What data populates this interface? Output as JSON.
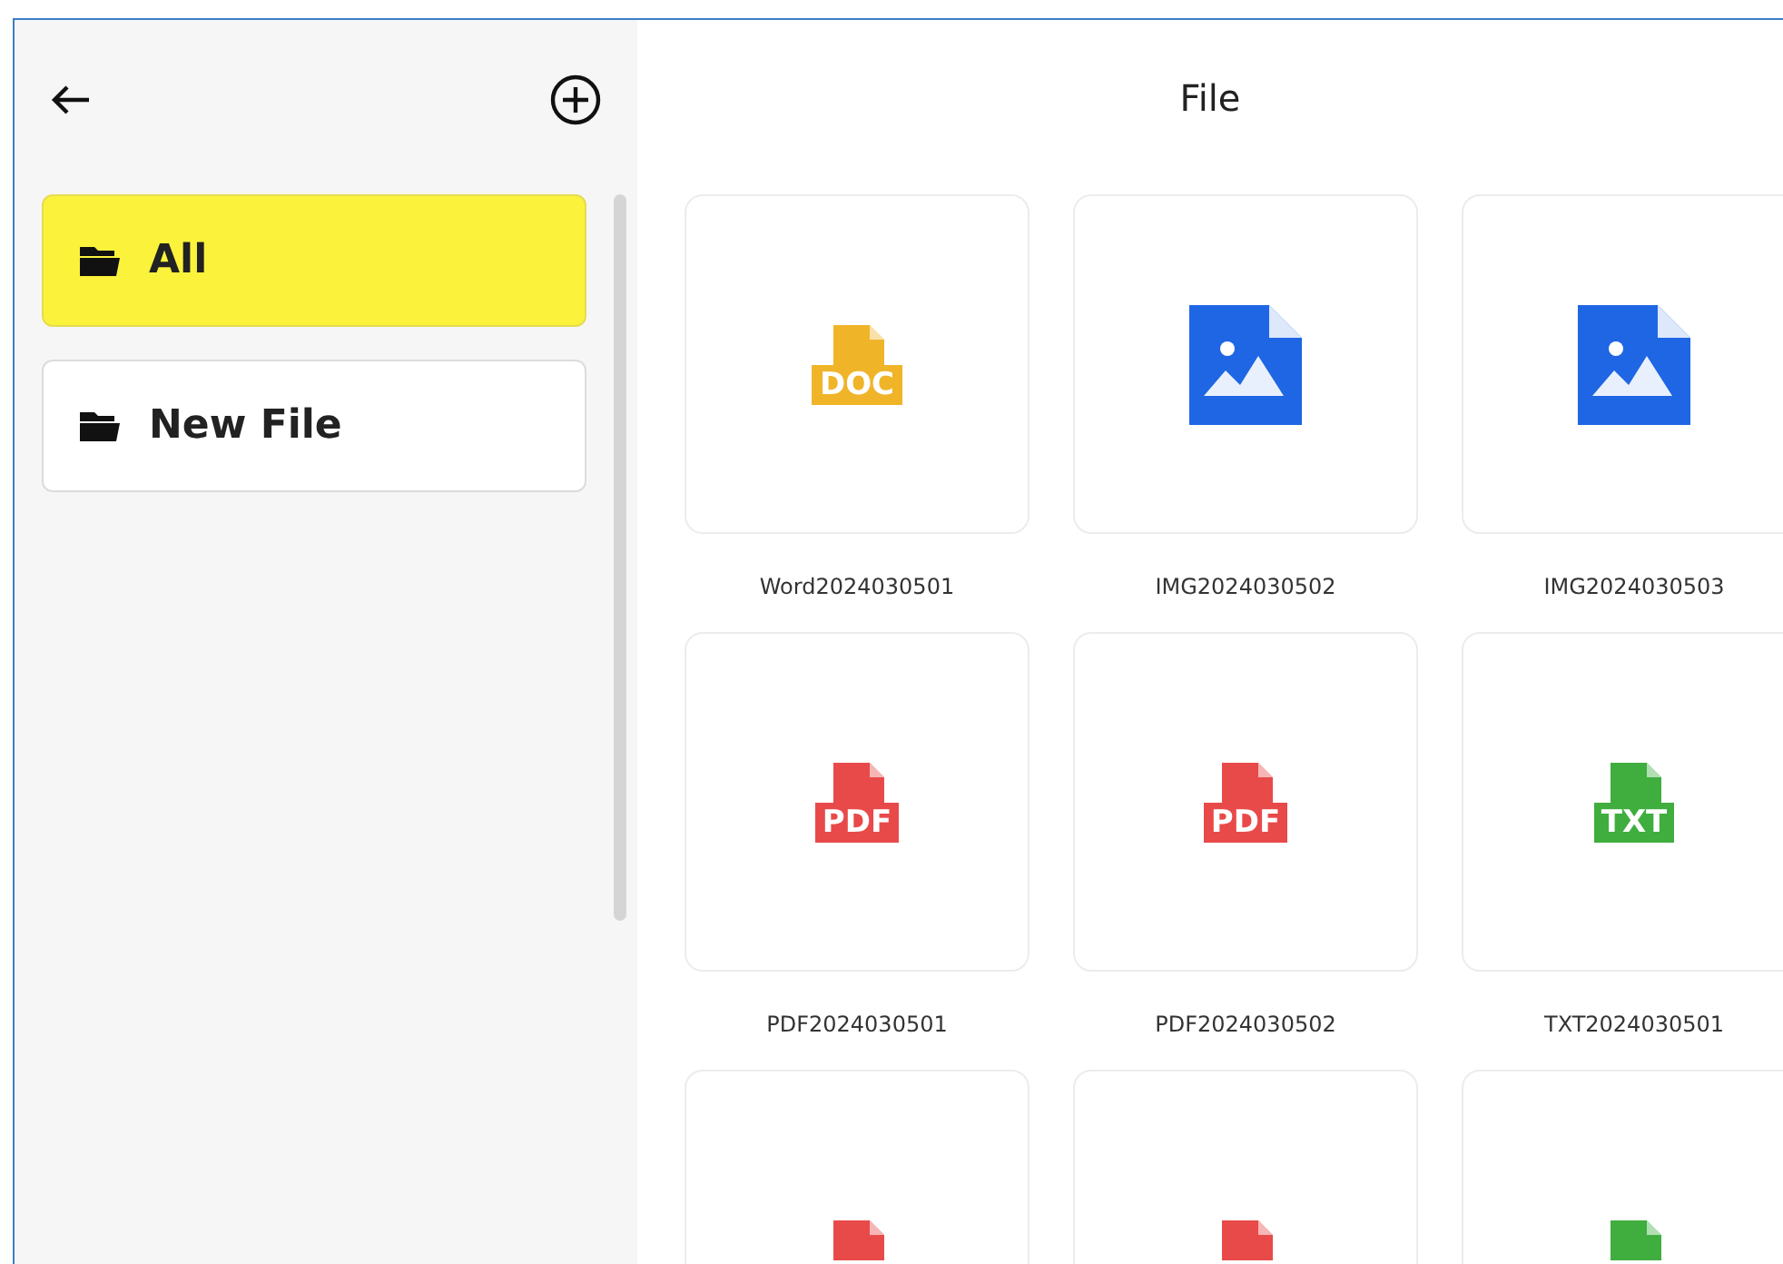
{
  "sidebar": {
    "folders": [
      {
        "label": "All",
        "selected": true
      },
      {
        "label": "New File",
        "selected": false
      }
    ]
  },
  "main": {
    "title": "File",
    "files": [
      {
        "kind": "doc",
        "badge": "DOC",
        "name": "Word2024030501"
      },
      {
        "kind": "image",
        "name": "IMG2024030502"
      },
      {
        "kind": "image",
        "name": "IMG2024030503"
      },
      {
        "kind": "pdf",
        "badge": "PDF",
        "name": "PDF2024030501"
      },
      {
        "kind": "pdf",
        "badge": "PDF",
        "name": "PDF2024030502"
      },
      {
        "kind": "txt",
        "badge": "TXT",
        "name": "TXT2024030501"
      },
      {
        "kind": "pdf"
      },
      {
        "kind": "pdf"
      },
      {
        "kind": "txt"
      }
    ]
  }
}
